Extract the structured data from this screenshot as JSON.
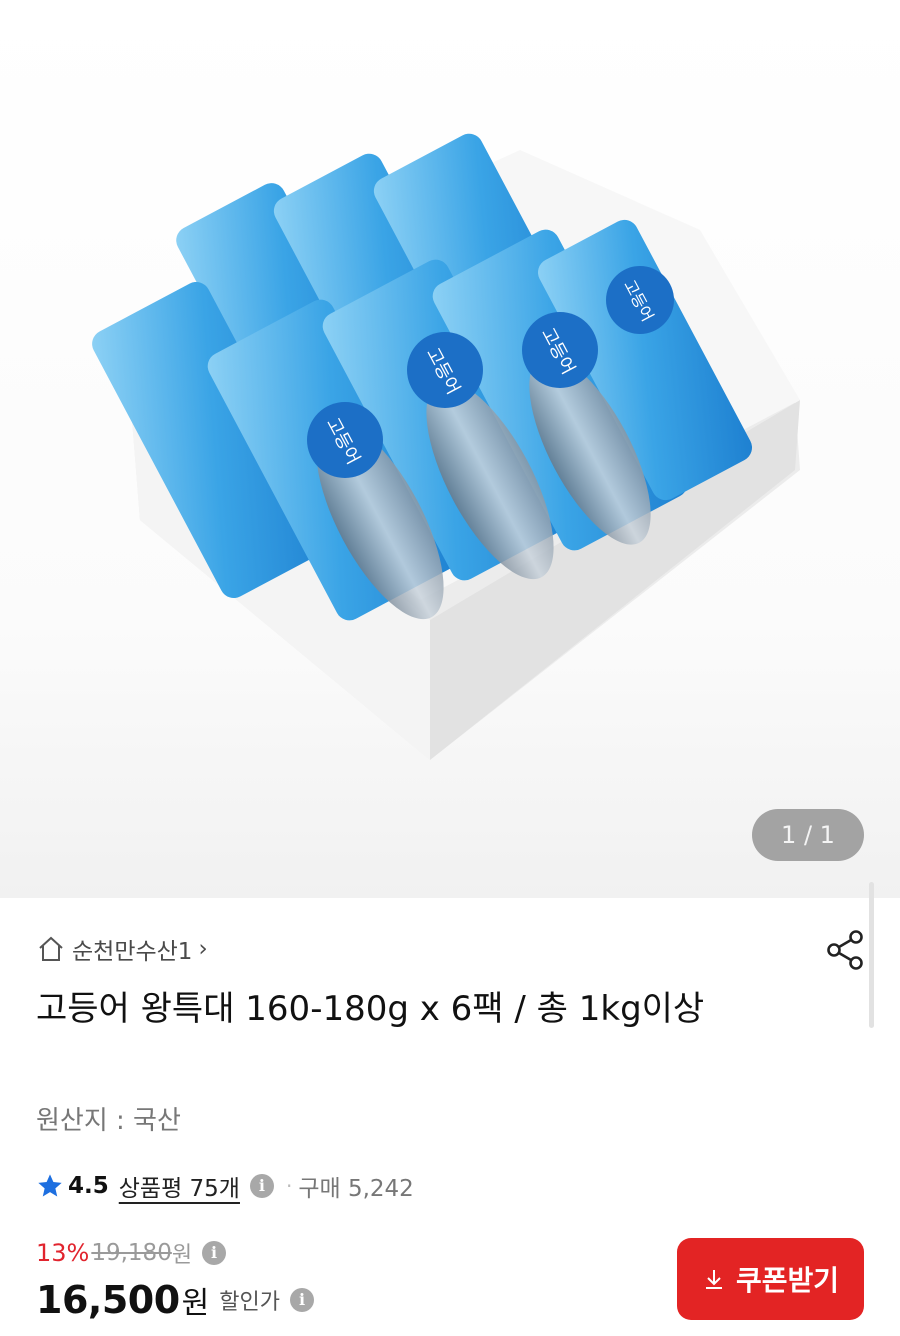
{
  "gallery": {
    "counter": "1 / 1"
  },
  "store": {
    "name": "순천만수산1"
  },
  "product": {
    "title": "고등어 왕특대 160-180g x 6팩 / 총 1kg이상",
    "origin": "원산지 : 국산",
    "package_label": "고등어"
  },
  "rating": {
    "score": "4.5",
    "reviews_label": "상품평 75개",
    "purchase_label": "구매 5,242"
  },
  "price": {
    "discount": "13%",
    "original": "19,180",
    "original_unit": "원",
    "sale": "16,500",
    "sale_unit": "원",
    "sale_label": "할인가"
  },
  "coupon": {
    "label": "쿠폰받기"
  },
  "colors": {
    "accent": "#e32424",
    "discount": "#e1242e",
    "star": "#1d6fe0"
  }
}
